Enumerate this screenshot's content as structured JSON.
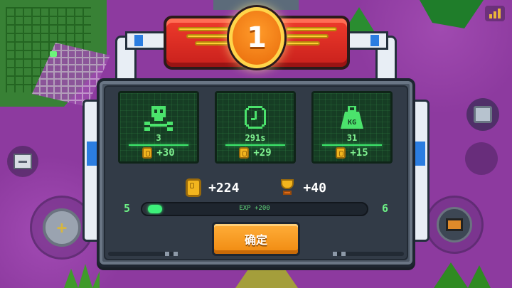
{
  "rank": "1",
  "stats": [
    {
      "icon": "skull-icon",
      "value": "3",
      "bonus": "+30"
    },
    {
      "icon": "clock-icon",
      "value": "291s",
      "bonus": "+29"
    },
    {
      "icon": "weight-icon",
      "icon_text": "KG",
      "value": "31",
      "bonus": "+15"
    }
  ],
  "rewards": {
    "coins": "+224",
    "trophies": "+40"
  },
  "level": {
    "current": "5",
    "next": "6",
    "exp_label": "EXP +200",
    "progress": 0.04
  },
  "confirm_label": "确定",
  "colors": {
    "accent": "#f08a10",
    "panel": "#323b47",
    "screen_green": "#163d24",
    "text_green": "#7ef08f",
    "banner_red": "#e02a22"
  }
}
